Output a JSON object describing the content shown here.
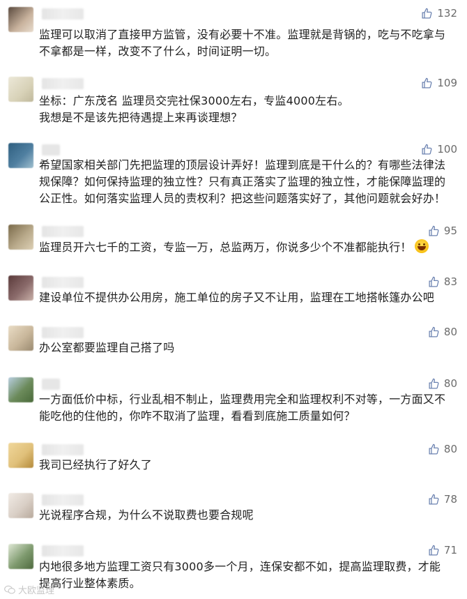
{
  "comments": [
    {
      "likes": "132",
      "lines": [
        "监理可以取消了直接甲方监管，没有必要十不准。监理就是背锅的，吃与不吃拿与",
        "不拿都是一样，改变不了什么，时间证明一切。"
      ],
      "avatar": "#c9b39e"
    },
    {
      "likes": "109",
      "lines": [
        "坐标：广东茂名 监理员交完社保3000左右，专监4000左右。",
        "我想是不是该先把待遇提上来再谈理想？"
      ],
      "avatar": "#d8d2b8"
    },
    {
      "likes": "100",
      "lines": [
        "希望国家相关部门先把监理的顶层设计弄好！监理到底是干什么的？有哪些法律法",
        "规保障？如何保持监理的独立性？只有真正落实了监理的独立性，才能保障监理的",
        "公正性。如何落实监理人员的责权利？把这些问题落实好了，其他问题就会好办！"
      ],
      "avatar": "#4f7fa0"
    },
    {
      "likes": "95",
      "lines": [
        "监理员开六七千的工资，专监一万，总监两万，你说多少个不准都能执行！"
      ],
      "avatar": "#b8a98a"
    },
    {
      "likes": "83",
      "lines": [
        "建设单位不提供办公用房，施工单位的房子又不让用，监理在工地搭帐篷办公吧"
      ],
      "avatar": "#8a6a6a"
    },
    {
      "likes": "80",
      "lines": [
        "办公室都要监理自己搭了吗"
      ],
      "avatar": "#c9b79b"
    },
    {
      "likes": "80",
      "lines": [
        "一方面低价中标，行业乱相不制止，监理费用完全和监理权利不对等，一方面又不",
        "能吃他的住他的，你咋不取消了监理，看看到底施工质量如何？"
      ],
      "avatar": "#6b8a5a"
    },
    {
      "likes": "80",
      "lines": [
        "我司已经执行了好久了"
      ],
      "avatar": "#e0c07a"
    },
    {
      "likes": "78",
      "lines": [
        "光说程序合规，为什么不说取费也要合规呢"
      ],
      "avatar": "#d9cfc6"
    },
    {
      "likes": "71",
      "lines": [
        "内地很多地方监理工资只有3000多一个月，连保安都不如，提高监理取费，才能",
        "提高行业整体素质。"
      ],
      "avatar": "#7e9a6e"
    }
  ],
  "watermark": "大欧监理"
}
